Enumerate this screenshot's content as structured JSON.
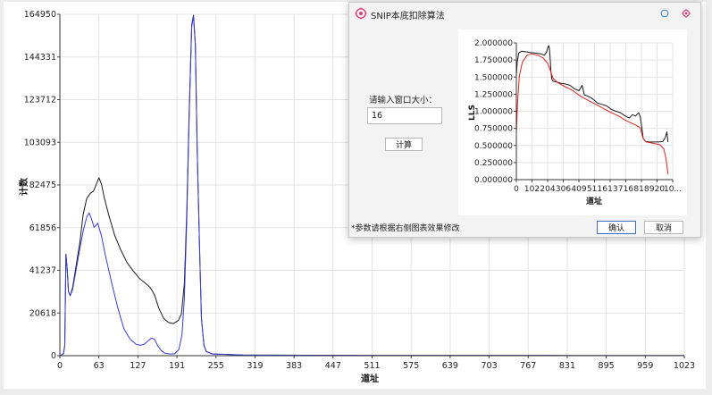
{
  "colors": {
    "black_series": "#1a1a1a",
    "blue_series": "#3a3ad8",
    "red_series": "#e02020",
    "grid": "#e3e3e3",
    "accent": "#3d6bbd"
  },
  "chart_data": [
    {
      "type": "line",
      "xlabel": "道址",
      "ylabel": "计数",
      "xlim": [
        0,
        1023
      ],
      "ylim": [
        0,
        164950
      ],
      "x_ticks": [
        "0",
        "63",
        "127",
        "191",
        "255",
        "319",
        "383",
        "447",
        "511",
        "575",
        "639",
        "703",
        "767",
        "831",
        "895",
        "959",
        "1023"
      ],
      "y_ticks": [
        "0",
        "20618",
        "41237",
        "61856",
        "82475",
        "103093",
        "123712",
        "144331",
        "164950"
      ],
      "grid": true,
      "series": [
        {
          "color": "#1a1a1a",
          "points": [
            [
              0,
              0
            ],
            [
              6,
              1000
            ],
            [
              8,
              5000
            ],
            [
              10,
              49000
            ],
            [
              12,
              42000
            ],
            [
              14,
              31000
            ],
            [
              17,
              29000
            ],
            [
              21,
              33000
            ],
            [
              27,
              44000
            ],
            [
              33,
              55000
            ],
            [
              38,
              68000
            ],
            [
              44,
              76000
            ],
            [
              50,
              78500
            ],
            [
              55,
              79500
            ],
            [
              60,
              83000
            ],
            [
              64,
              86000
            ],
            [
              68,
              83000
            ],
            [
              73,
              76000
            ],
            [
              80,
              68000
            ],
            [
              90,
              58000
            ],
            [
              100,
              51000
            ],
            [
              110,
              45000
            ],
            [
              120,
              41000
            ],
            [
              130,
              37500
            ],
            [
              140,
              35000
            ],
            [
              148,
              33000
            ],
            [
              155,
              29500
            ],
            [
              162,
              23000
            ],
            [
              170,
              18000
            ],
            [
              178,
              16000
            ],
            [
              186,
              15500
            ],
            [
              194,
              17000
            ],
            [
              199,
              20000
            ],
            [
              204,
              35000
            ],
            [
              208,
              70000
            ],
            [
              212,
              120000
            ],
            [
              216,
              160000
            ],
            [
              219,
              164500
            ],
            [
              222,
              150000
            ],
            [
              225,
              100000
            ],
            [
              229,
              50000
            ],
            [
              232,
              18000
            ],
            [
              236,
              5000
            ],
            [
              240,
              2000
            ],
            [
              250,
              800
            ],
            [
              300,
              350
            ],
            [
              400,
              200
            ],
            [
              500,
              150
            ],
            [
              600,
              120
            ],
            [
              700,
              100
            ],
            [
              800,
              80
            ],
            [
              900,
              60
            ],
            [
              1023,
              40
            ]
          ]
        },
        {
          "color": "#3a3ad8",
          "points": [
            [
              0,
              0
            ],
            [
              6,
              1000
            ],
            [
              8,
              5000
            ],
            [
              10,
              49000
            ],
            [
              12,
              42000
            ],
            [
              14,
              31000
            ],
            [
              17,
              29000
            ],
            [
              21,
              32000
            ],
            [
              27,
              42000
            ],
            [
              33,
              52000
            ],
            [
              38,
              60000
            ],
            [
              44,
              67000
            ],
            [
              48,
              69000
            ],
            [
              52,
              66000
            ],
            [
              56,
              62000
            ],
            [
              62,
              64000
            ],
            [
              68,
              58000
            ],
            [
              75,
              48000
            ],
            [
              85,
              35000
            ],
            [
              95,
              23000
            ],
            [
              105,
              13000
            ],
            [
              115,
              8000
            ],
            [
              125,
              5500
            ],
            [
              132,
              5000
            ],
            [
              138,
              5500
            ],
            [
              144,
              7000
            ],
            [
              150,
              8500
            ],
            [
              155,
              8000
            ],
            [
              160,
              5000
            ],
            [
              166,
              2500
            ],
            [
              172,
              1200
            ],
            [
              180,
              800
            ],
            [
              188,
              900
            ],
            [
              195,
              3000
            ],
            [
              200,
              10000
            ],
            [
              204,
              28000
            ],
            [
              208,
              66000
            ],
            [
              212,
              118000
            ],
            [
              216,
              159000
            ],
            [
              219,
              164000
            ],
            [
              222,
              150000
            ],
            [
              225,
              100000
            ],
            [
              229,
              50000
            ],
            [
              232,
              18000
            ],
            [
              236,
              5000
            ],
            [
              240,
              2000
            ],
            [
              250,
              800
            ],
            [
              300,
              350
            ],
            [
              400,
              200
            ],
            [
              500,
              150
            ],
            [
              600,
              120
            ],
            [
              700,
              100
            ],
            [
              800,
              80
            ],
            [
              900,
              60
            ],
            [
              1023,
              40
            ]
          ]
        }
      ]
    },
    {
      "type": "line",
      "xlabel": "道址",
      "ylabel": "LLS",
      "xlim": [
        0,
        1023
      ],
      "ylim": [
        0,
        2
      ],
      "x_ticks": [
        "0",
        "102",
        "204",
        "306",
        "409",
        "511",
        "613",
        "716",
        "818",
        "920",
        "10..."
      ],
      "y_ticks": [
        "0.000000",
        "0.250000",
        "0.500000",
        "0.750000",
        "1.000000",
        "1.250000",
        "1.500000",
        "1.750000",
        "2.000000"
      ],
      "grid": true,
      "series": [
        {
          "color": "#1a1a1a",
          "points": [
            [
              0,
              1.52
            ],
            [
              6,
              1.72
            ],
            [
              15,
              1.85
            ],
            [
              35,
              1.88
            ],
            [
              60,
              1.87
            ],
            [
              90,
              1.86
            ],
            [
              130,
              1.85
            ],
            [
              160,
              1.84
            ],
            [
              185,
              1.82
            ],
            [
              198,
              1.87
            ],
            [
              206,
              1.93
            ],
            [
              212,
              1.96
            ],
            [
              216,
              1.92
            ],
            [
              221,
              1.78
            ],
            [
              226,
              1.58
            ],
            [
              232,
              1.47
            ],
            [
              240,
              1.44
            ],
            [
              260,
              1.43
            ],
            [
              290,
              1.41
            ],
            [
              320,
              1.4
            ],
            [
              350,
              1.38
            ],
            [
              380,
              1.33
            ],
            [
              410,
              1.3
            ],
            [
              430,
              1.38
            ],
            [
              445,
              1.24
            ],
            [
              470,
              1.22
            ],
            [
              500,
              1.18
            ],
            [
              530,
              1.12
            ],
            [
              560,
              1.1
            ],
            [
              590,
              1.08
            ],
            [
              620,
              1.03
            ],
            [
              650,
              1.0
            ],
            [
              680,
              0.98
            ],
            [
              700,
              0.95
            ],
            [
              720,
              0.92
            ],
            [
              740,
              0.9
            ],
            [
              760,
              0.95
            ],
            [
              780,
              0.93
            ],
            [
              800,
              0.98
            ],
            [
              810,
              0.92
            ],
            [
              820,
              0.78
            ],
            [
              830,
              0.6
            ],
            [
              845,
              0.56
            ],
            [
              870,
              0.55
            ],
            [
              900,
              0.55
            ],
            [
              930,
              0.55
            ],
            [
              960,
              0.56
            ],
            [
              975,
              0.62
            ],
            [
              985,
              0.7
            ],
            [
              992,
              0.55
            ]
          ]
        },
        {
          "color": "#e02020",
          "points": [
            [
              0,
              0.68
            ],
            [
              8,
              1.15
            ],
            [
              20,
              1.52
            ],
            [
              40,
              1.72
            ],
            [
              70,
              1.82
            ],
            [
              100,
              1.84
            ],
            [
              140,
              1.82
            ],
            [
              175,
              1.78
            ],
            [
              205,
              1.7
            ],
            [
              225,
              1.58
            ],
            [
              240,
              1.48
            ],
            [
              270,
              1.42
            ],
            [
              320,
              1.36
            ],
            [
              370,
              1.3
            ],
            [
              420,
              1.22
            ],
            [
              470,
              1.16
            ],
            [
              520,
              1.1
            ],
            [
              570,
              1.04
            ],
            [
              620,
              0.98
            ],
            [
              670,
              0.93
            ],
            [
              720,
              0.86
            ],
            [
              780,
              0.8
            ],
            [
              810,
              0.76
            ],
            [
              830,
              0.6
            ],
            [
              850,
              0.55
            ],
            [
              900,
              0.53
            ],
            [
              940,
              0.51
            ],
            [
              965,
              0.45
            ],
            [
              980,
              0.3
            ],
            [
              992,
              0.08
            ]
          ]
        }
      ]
    }
  ],
  "dialog": {
    "title": "SNIP本底扣除算法",
    "window_size_label": "请输入窗口大小：",
    "window_size_value": "16",
    "compute_label": "计算",
    "hint": "*参数请根据右侧图表效果修改",
    "confirm_label": "确认",
    "cancel_label": "取消",
    "icons": {
      "app": "snip-app-icon",
      "help": "help-icon",
      "close": "close-icon"
    }
  }
}
